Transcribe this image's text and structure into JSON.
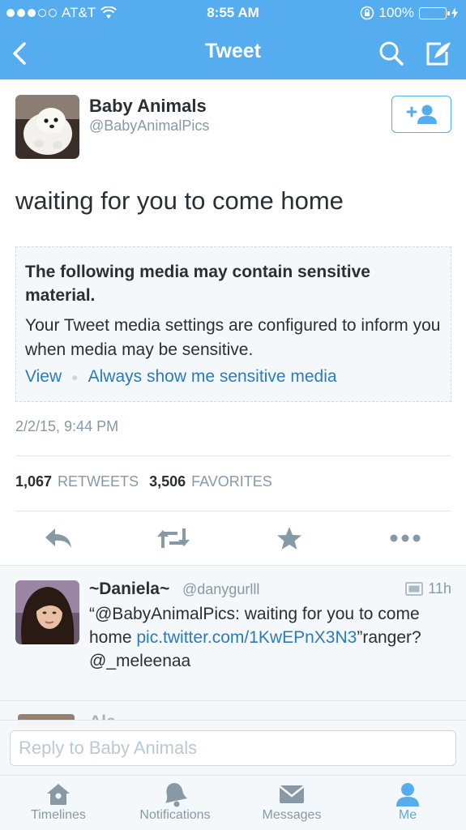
{
  "status_bar": {
    "carrier": "AT&T",
    "time": "8:55 AM",
    "battery": "100%"
  },
  "nav": {
    "title": "Tweet",
    "back_icon": "chevron-left-icon",
    "search_icon": "search-icon",
    "compose_icon": "compose-icon"
  },
  "tweet": {
    "author_name": "Baby Animals",
    "author_handle": "@BabyAnimalPics",
    "text": "waiting for you to come home",
    "sensitive_title": "The following media may contain sensitive material.",
    "sensitive_body": "Your Tweet media settings are configured to inform you when media may be sensitive.",
    "view_link": "View",
    "always_show_link": "Always show me sensitive media",
    "timestamp": "2/2/15, 9:44 PM",
    "retweet_count": "1,067",
    "retweet_label": "RETWEETS",
    "favorite_count": "3,506",
    "favorite_label": "FAVORITES"
  },
  "reply": {
    "name": "~Daniela~",
    "handle": "@danygurlll",
    "time": "11h",
    "text_pre": "“@BabyAnimalPics: waiting for you to come home ",
    "link": "pic.twitter.com/1KwEPnX3N3",
    "text_post": "”ranger? @_meleenaa"
  },
  "peek": {
    "name": "Ale"
  },
  "reply_bar": {
    "placeholder": "Reply to Baby Animals"
  },
  "tabs": [
    {
      "label": "Timelines",
      "icon": "home-icon"
    },
    {
      "label": "Notifications",
      "icon": "bell-icon"
    },
    {
      "label": "Messages",
      "icon": "envelope-icon"
    },
    {
      "label": "Me",
      "icon": "person-icon"
    }
  ],
  "colors": {
    "brand": "#55acee",
    "link": "#2b7bb9",
    "muted": "#8899a6"
  }
}
